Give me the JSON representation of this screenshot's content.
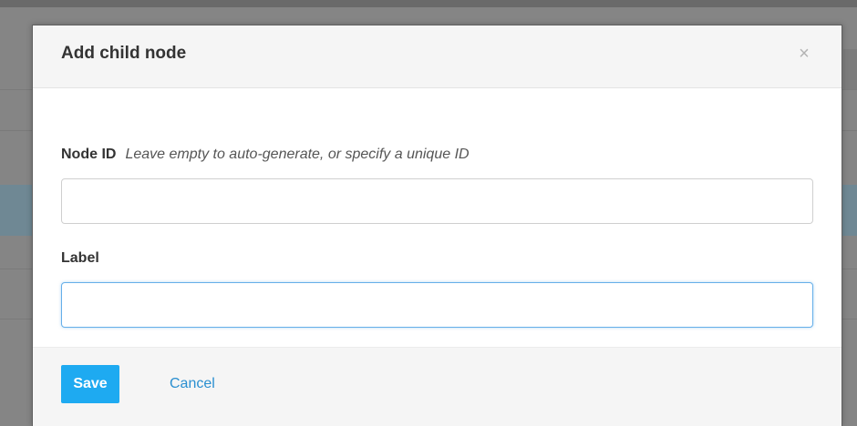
{
  "modal": {
    "title": "Add child node",
    "close_symbol": "×",
    "fields": {
      "node_id": {
        "label": "Node ID",
        "hint": "Leave empty to auto-generate, or specify a unique ID",
        "value": "",
        "placeholder": ""
      },
      "label": {
        "label": "Label",
        "value": "",
        "placeholder": ""
      }
    },
    "footer": {
      "save_label": "Save",
      "cancel_label": "Cancel"
    }
  },
  "colors": {
    "primary_button": "#1eaaf1",
    "link": "#2a8fd0",
    "focus_border": "#66afe9",
    "header_bg": "#f5f5f5"
  },
  "icons": {
    "close": "close-icon"
  }
}
